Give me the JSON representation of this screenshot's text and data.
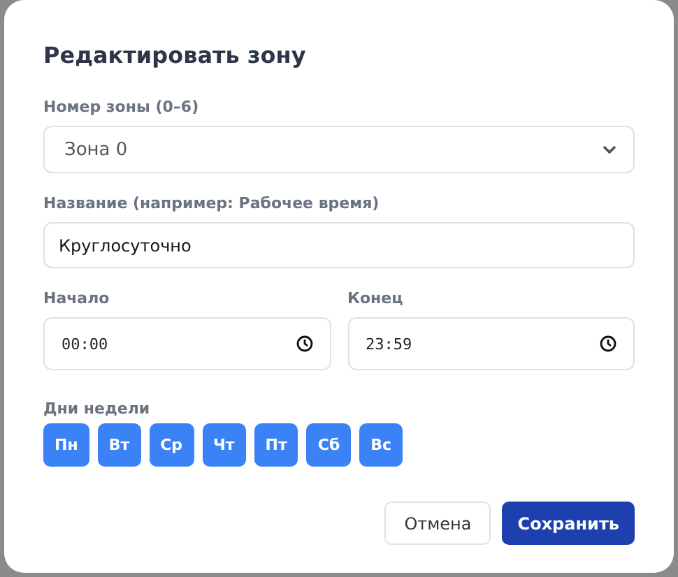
{
  "dialog": {
    "title": "Редактировать зону",
    "zone": {
      "label": "Номер зоны (0–6)",
      "value": "Зона 0"
    },
    "name": {
      "label": "Название (например: Рабочее время)",
      "value": "Круглосуточно"
    },
    "start": {
      "label": "Начало",
      "value": "00:00"
    },
    "end": {
      "label": "Конец",
      "value": "23:59"
    },
    "days_label": "Дни недели",
    "days": [
      {
        "label": "Пн",
        "selected": true
      },
      {
        "label": "Вт",
        "selected": true
      },
      {
        "label": "Ср",
        "selected": true
      },
      {
        "label": "Чт",
        "selected": true
      },
      {
        "label": "Пт",
        "selected": true
      },
      {
        "label": "Сб",
        "selected": true
      },
      {
        "label": "Вс",
        "selected": true
      }
    ],
    "buttons": [
      {
        "label": "Отмена",
        "kind": "secondary"
      },
      {
        "label": "Сохранить",
        "kind": "primary"
      }
    ]
  }
}
